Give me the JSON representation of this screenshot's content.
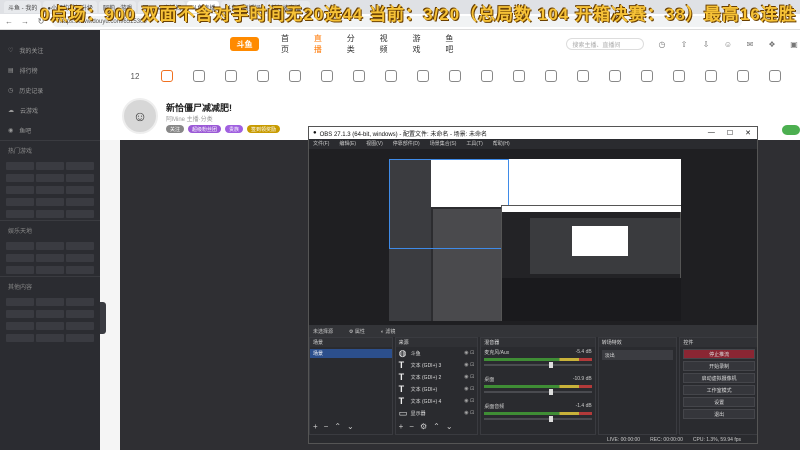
{
  "browser": {
    "tabs": [
      "斗鱼 - 我的",
      "●小红的重复升级",
      "阿莉 - 游戏",
      "阿Mine-直播间",
      "斗鱼直播",
      "斗鱼 - 直播间",
      "新加坡直播..."
    ],
    "url": "https://www.douyu.com/6515300"
  },
  "marquee": "0点场：900 双面不含对手时间无20选44 当前：3/20（总局数 104  开箱决赛：38）最高16连胜",
  "sidebar": {
    "items": [
      "我的关注",
      "排行榜",
      "历史记录",
      "云游戏",
      "鱼吧"
    ],
    "section1": "热门游戏",
    "section2": "娱乐天地",
    "section3": "其他内容"
  },
  "douyu": {
    "logo": "斗鱼",
    "nav": [
      "首页",
      "直播",
      "分类",
      "视频",
      "游戏",
      "鱼吧"
    ],
    "search_placeholder": "搜索主播、直播间",
    "icons": [
      "history-icon",
      "upload-icon",
      "download-icon",
      "user-icon",
      "message-icon",
      "gift-icon",
      "download-app-icon"
    ],
    "icon_row_count": "12",
    "streamer": {
      "title": "新恰僵尸减减肥!",
      "meta": "阿Mine  主播·分类",
      "badges": [
        "关注",
        "超级粉丝团",
        "贵族",
        "签到领奖励"
      ]
    }
  },
  "obs": {
    "title": "OBS 27.1.3 (64-bit, windows) - 配置文件: 未命名 - 场景: 未命名",
    "menu": [
      "文件(F)",
      "编辑(E)",
      "视图(V)",
      "停靠部件(D)",
      "场景集合(S)",
      "工具(T)",
      "帮助(H)"
    ],
    "bar_label": "未选择源",
    "bar_props": "属性",
    "bar_filters": "滤镜",
    "docks": {
      "scenes": "场景",
      "sources": "来源",
      "mixer": "混音器",
      "transitions": "转场特效",
      "controls": "控件"
    },
    "scene_item": "场景",
    "sources": [
      {
        "type": "browser",
        "name": "斗鱼"
      },
      {
        "type": "text",
        "name": "文本 (GDI+) 3"
      },
      {
        "type": "text",
        "name": "文本 (GDI+) 2"
      },
      {
        "type": "text",
        "name": "文本 (GDI+)"
      },
      {
        "type": "text",
        "name": "文本 (GDI+) 4"
      },
      {
        "type": "display",
        "name": "显示器"
      }
    ],
    "mixer": [
      {
        "name": "麦克风/Aux",
        "db": "-5.4 dB"
      },
      {
        "name": "桌面",
        "db": "-10.9 dB"
      },
      {
        "name": "桌面音频",
        "db": "-1.4 dB"
      }
    ],
    "transition": "淡出",
    "controls": [
      "停止推流",
      "开始录制",
      "启动虚拟摄像机",
      "工作室模式",
      "设置",
      "退出"
    ],
    "status": {
      "live": "LIVE: 00:00:00",
      "rec": "REC: 00:00:00",
      "cpu": "CPU: 1.3%, 59.94 fps"
    }
  }
}
